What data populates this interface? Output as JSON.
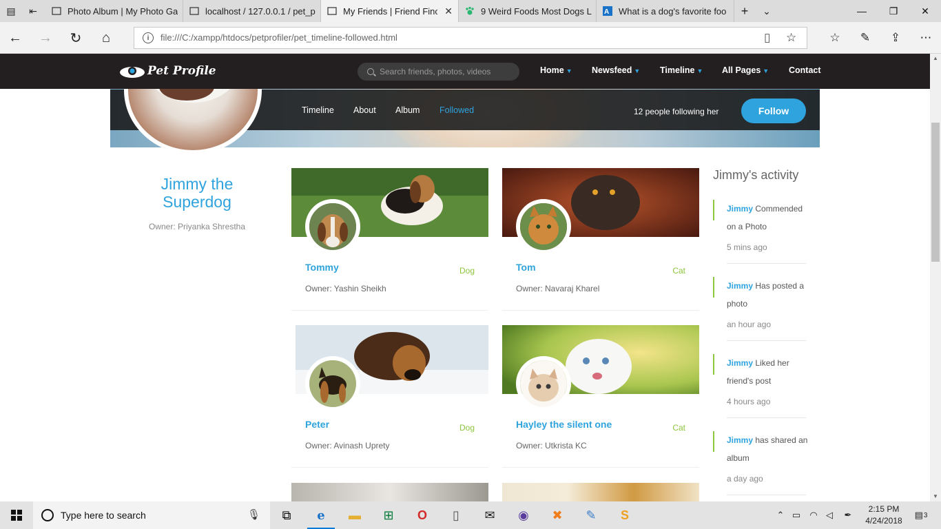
{
  "browser": {
    "tabs": [
      {
        "label": "Photo Album | My Photo Ga",
        "icon": "page-icon"
      },
      {
        "label": "localhost / 127.0.0.1 / pet_p",
        "icon": "page-icon"
      },
      {
        "label": "My Friends | Friend Finc",
        "icon": "page-icon",
        "active": true
      },
      {
        "label": "9 Weird Foods Most Dogs L",
        "icon": "paw-icon"
      },
      {
        "label": "What is a dog's favorite foo",
        "icon": "answer-icon"
      }
    ],
    "url": "file:///C:/xampp/htdocs/petprofiler/pet_timeline-followed.html"
  },
  "site": {
    "logo_text": "Pet Profile",
    "search_placeholder": "Search friends, photos, videos",
    "menu": [
      {
        "label": "Home",
        "dropdown": true
      },
      {
        "label": "Newsfeed",
        "dropdown": true
      },
      {
        "label": "Timeline",
        "dropdown": true
      },
      {
        "label": "All Pages",
        "dropdown": true
      },
      {
        "label": "Contact",
        "dropdown": false
      }
    ],
    "accent_color": "#2ea3dd",
    "green_color": "#8dc63f"
  },
  "profile": {
    "tabs": [
      "Timeline",
      "About",
      "Album",
      "Followed"
    ],
    "active_tab": "Followed",
    "followers_text": "12 people following her",
    "follow_button": "Follow",
    "name": "Jimmy the Superdog",
    "owner": "Owner: Priyanka Shrestha"
  },
  "followed": [
    {
      "name": "Tommy",
      "type": "Dog",
      "owner": "Owner: Yashin Sheikh"
    },
    {
      "name": "Tom",
      "type": "Cat",
      "owner": "Owner: Navaraj Kharel"
    },
    {
      "name": "Peter",
      "type": "Dog",
      "owner": "Owner: Avinash Uprety"
    },
    {
      "name": "Hayley the silent one",
      "type": "Cat",
      "owner": "Owner: Utkrista KC"
    }
  ],
  "activity": {
    "title": "Jimmy's activity",
    "items": [
      {
        "who": "Jimmy",
        "text": " Commended on a Photo",
        "time": "5 mins ago"
      },
      {
        "who": "Jimmy",
        "text": " Has posted a photo",
        "time": "an hour ago"
      },
      {
        "who": "Jimmy",
        "text": " Liked her friend's post",
        "time": "4 hours ago"
      },
      {
        "who": "Jimmy",
        "text": " has shared an album",
        "time": "a day ago"
      }
    ]
  },
  "taskbar": {
    "search_placeholder": "Type here to search",
    "time": "2:15 PM",
    "date": "4/24/2018",
    "notification_count": "3"
  }
}
